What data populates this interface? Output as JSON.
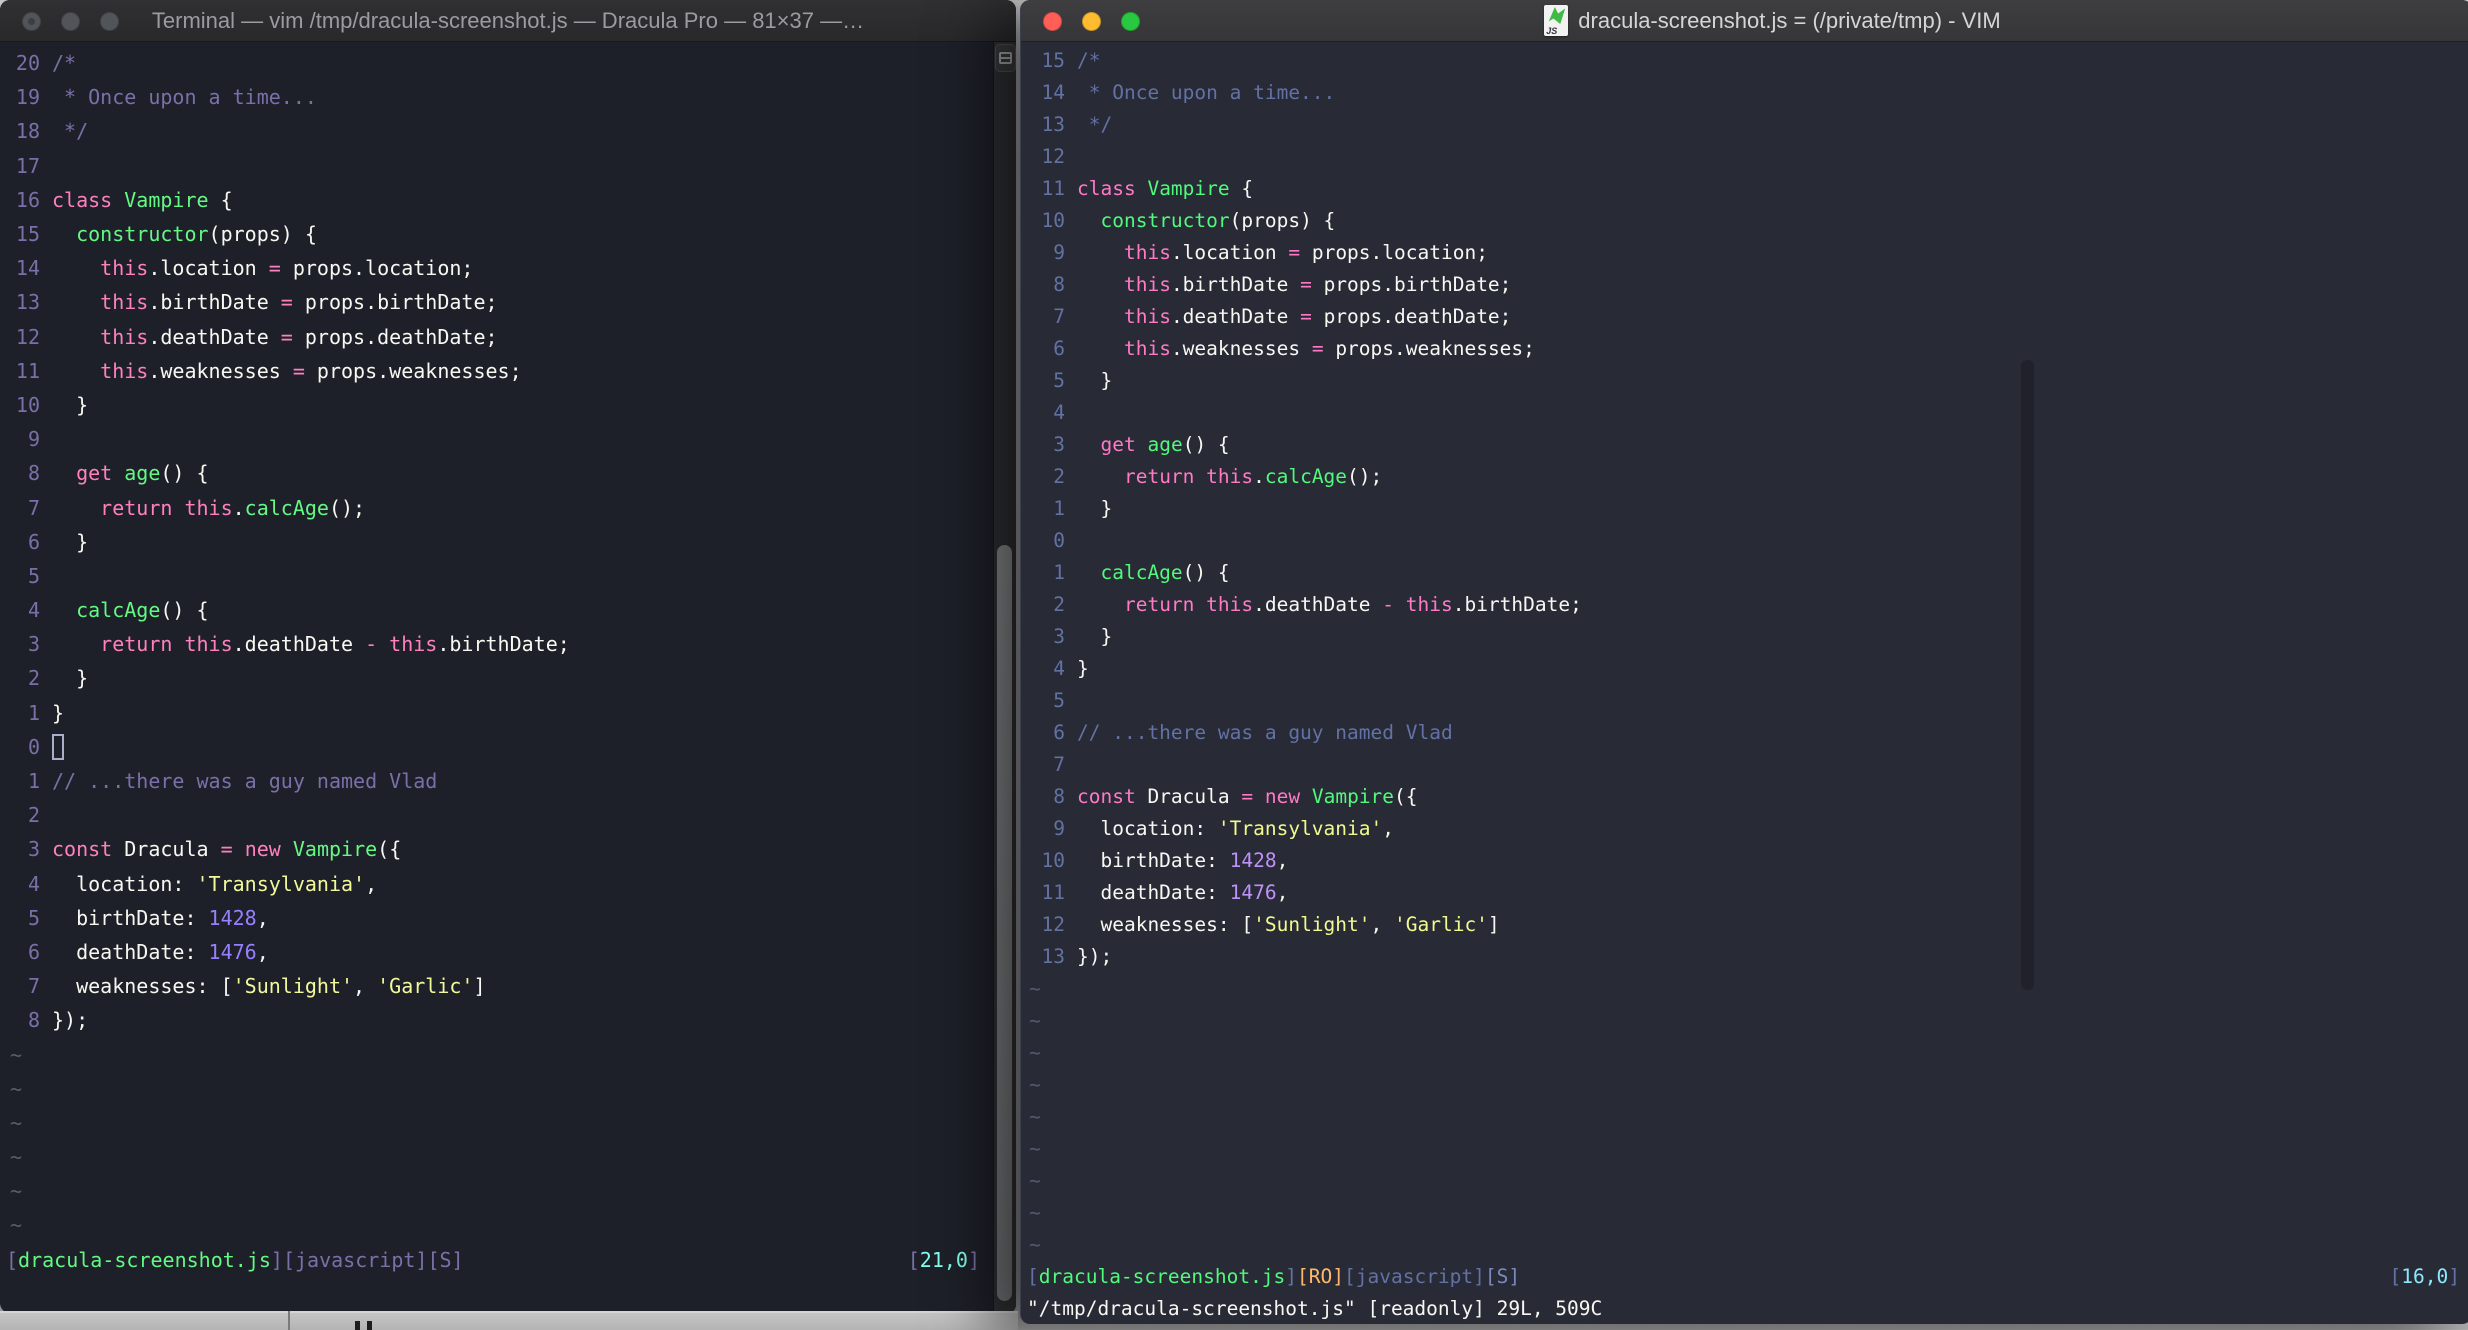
{
  "left_window": {
    "title": "Terminal — vim /tmp/dracula-screenshot.js — Dracula Pro — 81×37 —…",
    "rel_numbers": [
      "20",
      "19",
      "18",
      "17",
      "16",
      "15",
      "14",
      "13",
      "12",
      "11",
      "10",
      "9",
      "8",
      "7",
      "6",
      "5",
      "4",
      "3",
      "2",
      "1",
      "0",
      "1",
      "2",
      "3",
      "4",
      "5",
      "6",
      "7",
      "8"
    ],
    "cursor_line": 20,
    "tilde_count": 6,
    "tilde_char": "~",
    "status_tokens": [
      [
        "br",
        "["
      ],
      [
        "gr",
        "dracula-screenshot.js"
      ],
      [
        "br",
        "][javascript][S]"
      ]
    ],
    "ruler_tokens": [
      [
        "br",
        "["
      ],
      [
        "cy",
        "21,0"
      ],
      [
        "br",
        "]"
      ]
    ],
    "command_line": "",
    "palette": {
      "bg": "#1E2029",
      "fg": "#F8F8F2",
      "pink": "#FF80BF",
      "green": "#63F983",
      "yellow": "#F2F99B",
      "purple": "#9580FF",
      "comment": "#7970A9",
      "num": "#7970A9",
      "cyan": "#80FFEA",
      "bracket": "#7970A9",
      "tilde": "#5B5D63",
      "title_bg": "#303032",
      "title_bg_b": "#29292B",
      "title_fg": "#9C9CA0"
    }
  },
  "right_window": {
    "title": "dracula-screenshot.js = (/private/tmp) - VIM",
    "icon_label": "JS",
    "rel_numbers": [
      "15",
      "14",
      "13",
      "12",
      "11",
      "10",
      "9",
      "8",
      "7",
      "6",
      "5",
      "4",
      "3",
      "2",
      "1",
      "0",
      "1",
      "2",
      "3",
      "4",
      "5",
      "6",
      "7",
      "8",
      "9",
      "10",
      "11",
      "12",
      "13"
    ],
    "cursor_line": null,
    "tilde_count": 9,
    "tilde_char": "~",
    "status_tokens": [
      [
        "br",
        "["
      ],
      [
        "gr",
        "dracula-screenshot.js"
      ],
      [
        "br",
        "]"
      ],
      [
        "o",
        "[RO]"
      ],
      [
        "br",
        "[javascript]"
      ],
      [
        "sb",
        "[S]"
      ]
    ],
    "ruler_tokens": [
      [
        "br",
        "["
      ],
      [
        "cy",
        "16,0"
      ],
      [
        "br",
        "]"
      ]
    ],
    "command_line": "\"/tmp/dracula-screenshot.js\" [readonly] 29L, 509C",
    "palette": {
      "bg": "#282A36",
      "fg": "#F8F8F2",
      "pink": "#FF79C6",
      "green": "#50FA7B",
      "yellow": "#F1FA8C",
      "purple": "#BD93F9",
      "comment": "#6272A4",
      "num": "#6272A4",
      "cyan": "#8BE9FD",
      "bracket": "#6272A4",
      "orange": "#FFB86C",
      "s_badge": "#7B89BC",
      "tilde": "#545B70",
      "title_bg": "#3E3E40",
      "title_bg_b": "#363638",
      "title_fg": "#D5D5D7",
      "light_red": "#FF5F57",
      "light_yellow": "#FEBC2E",
      "light_green": "#28C840"
    }
  },
  "code_lines": [
    [
      [
        "c",
        "/*"
      ]
    ],
    [
      [
        "c",
        " * Once upon a time..."
      ]
    ],
    [
      [
        "c",
        " */"
      ]
    ],
    [],
    [
      [
        "k",
        "class"
      ],
      [
        "f",
        " "
      ],
      [
        "g",
        "Vampire"
      ],
      [
        "f",
        " {"
      ]
    ],
    [
      [
        "f",
        "  "
      ],
      [
        "g",
        "constructor"
      ],
      [
        "f",
        "(props) {"
      ]
    ],
    [
      [
        "f",
        "    "
      ],
      [
        "k",
        "this"
      ],
      [
        "f",
        ".location "
      ],
      [
        "k",
        "="
      ],
      [
        "f",
        " props.location;"
      ]
    ],
    [
      [
        "f",
        "    "
      ],
      [
        "k",
        "this"
      ],
      [
        "f",
        ".birthDate "
      ],
      [
        "k",
        "="
      ],
      [
        "f",
        " props.birthDate;"
      ]
    ],
    [
      [
        "f",
        "    "
      ],
      [
        "k",
        "this"
      ],
      [
        "f",
        ".deathDate "
      ],
      [
        "k",
        "="
      ],
      [
        "f",
        " props.deathDate;"
      ]
    ],
    [
      [
        "f",
        "    "
      ],
      [
        "k",
        "this"
      ],
      [
        "f",
        ".weaknesses "
      ],
      [
        "k",
        "="
      ],
      [
        "f",
        " props.weaknesses;"
      ]
    ],
    [
      [
        "f",
        "  }"
      ]
    ],
    [],
    [
      [
        "f",
        "  "
      ],
      [
        "k",
        "get"
      ],
      [
        "f",
        " "
      ],
      [
        "g",
        "age"
      ],
      [
        "f",
        "() {"
      ]
    ],
    [
      [
        "f",
        "    "
      ],
      [
        "k",
        "return this"
      ],
      [
        "f",
        "."
      ],
      [
        "g",
        "calcAge"
      ],
      [
        "f",
        "();"
      ]
    ],
    [
      [
        "f",
        "  }"
      ]
    ],
    [],
    [
      [
        "f",
        "  "
      ],
      [
        "g",
        "calcAge"
      ],
      [
        "f",
        "() {"
      ]
    ],
    [
      [
        "f",
        "    "
      ],
      [
        "k",
        "return this"
      ],
      [
        "f",
        ".deathDate "
      ],
      [
        "k",
        "-"
      ],
      [
        "f",
        " "
      ],
      [
        "k",
        "this"
      ],
      [
        "f",
        ".birthDate;"
      ]
    ],
    [
      [
        "f",
        "  }"
      ]
    ],
    [
      [
        "f",
        "}"
      ]
    ],
    [],
    [
      [
        "c",
        "// ...there was a guy named Vlad"
      ]
    ],
    [],
    [
      [
        "k",
        "const"
      ],
      [
        "f",
        " Dracula "
      ],
      [
        "k",
        "="
      ],
      [
        "f",
        " "
      ],
      [
        "k",
        "new"
      ],
      [
        "f",
        " "
      ],
      [
        "g",
        "Vampire"
      ],
      [
        "f",
        "({"
      ]
    ],
    [
      [
        "f",
        "  location: "
      ],
      [
        "y",
        "'Transylvania'"
      ],
      [
        "f",
        ","
      ]
    ],
    [
      [
        "f",
        "  birthDate: "
      ],
      [
        "p",
        "1428"
      ],
      [
        "f",
        ","
      ]
    ],
    [
      [
        "f",
        "  deathDate: "
      ],
      [
        "p",
        "1476"
      ],
      [
        "f",
        ","
      ]
    ],
    [
      [
        "f",
        "  weaknesses: ["
      ],
      [
        "y",
        "'Sunlight'"
      ],
      [
        "f",
        ", "
      ],
      [
        "y",
        "'Garlic'"
      ],
      [
        "f",
        "]"
      ]
    ],
    [
      [
        "f",
        "});"
      ]
    ]
  ]
}
